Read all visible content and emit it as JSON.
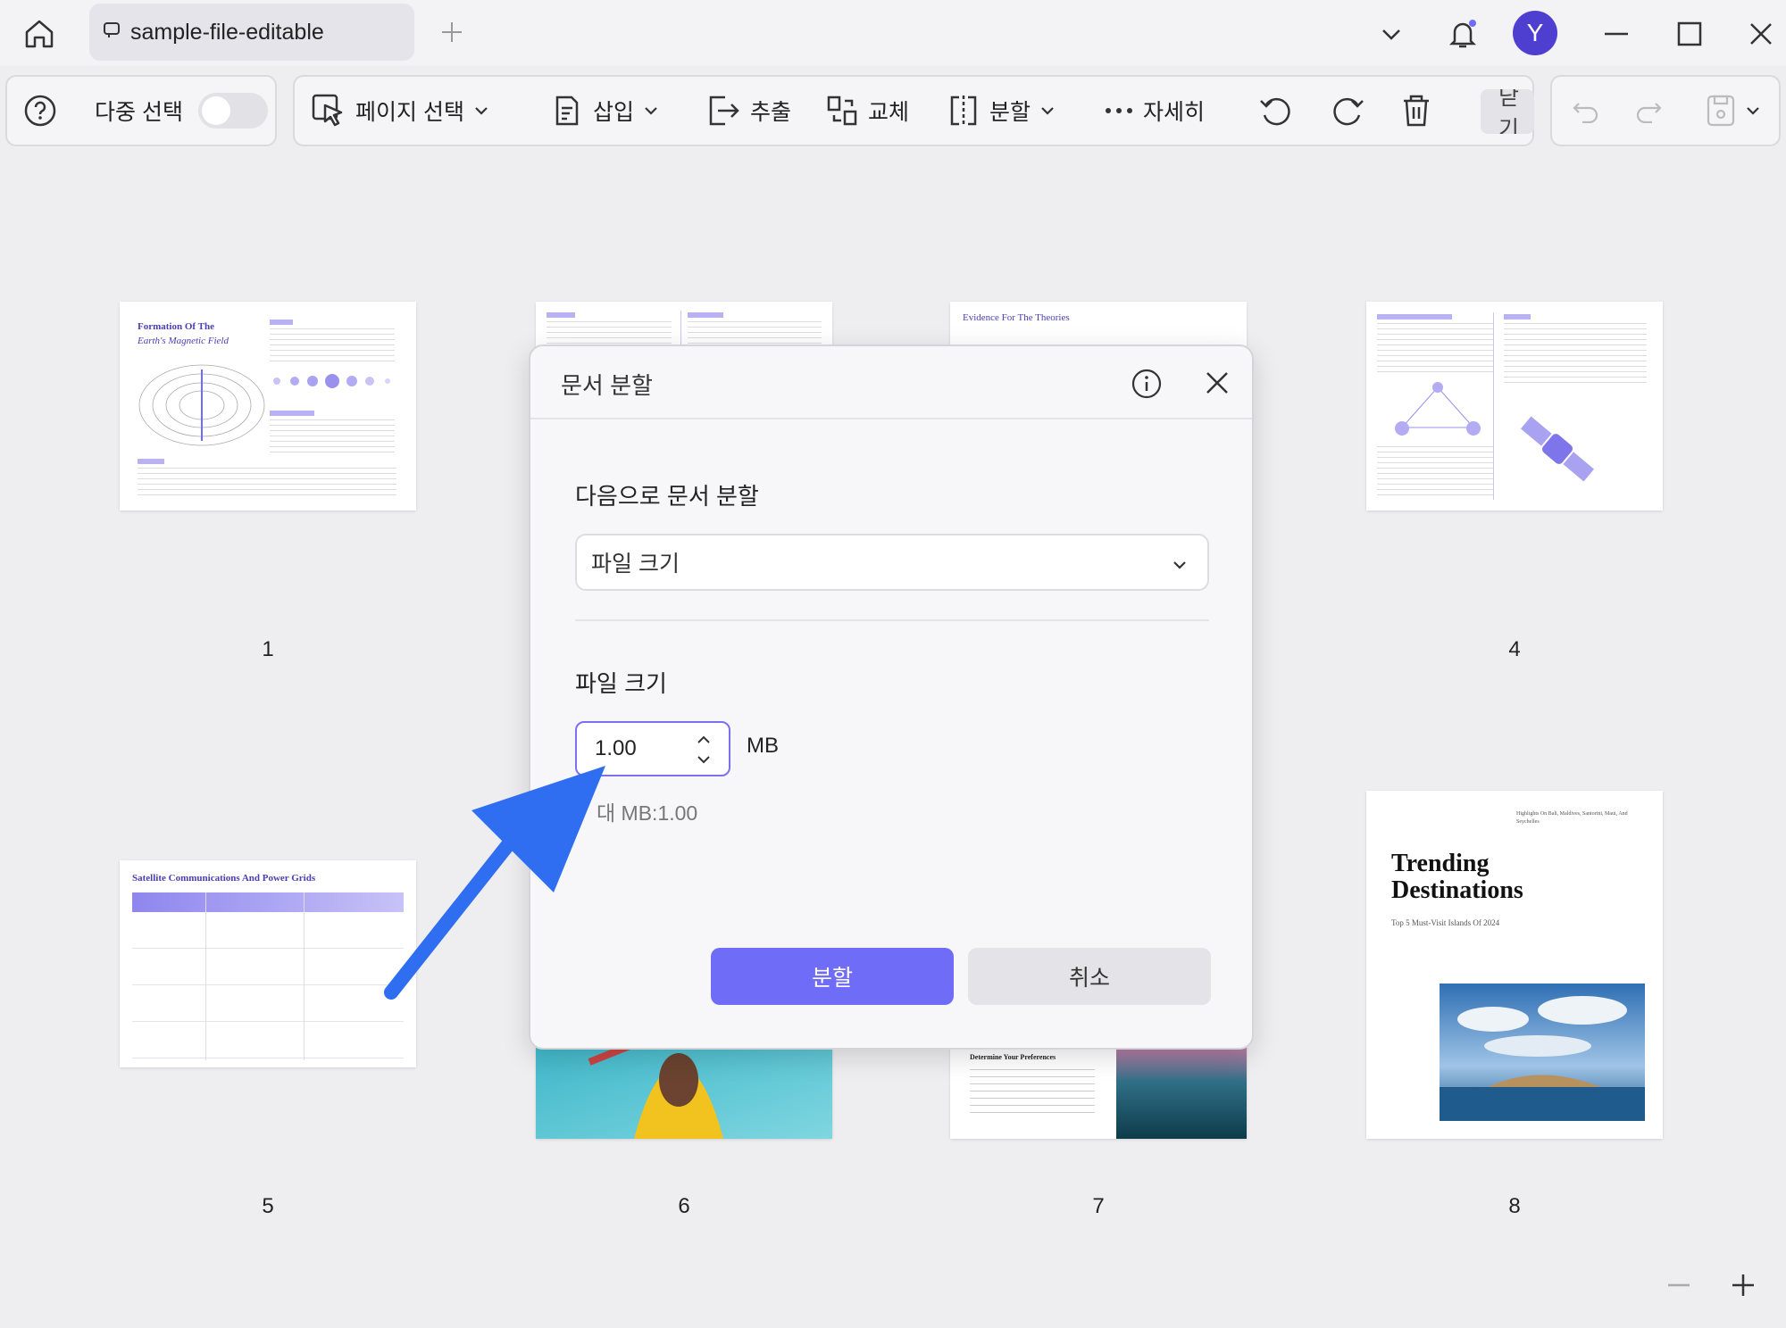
{
  "titlebar": {
    "tab_title": "sample-file-editable",
    "avatar_letter": "Y"
  },
  "toolbar": {
    "multi_select_label": "다중 선택",
    "page_select_label": "페이지 선택",
    "insert_label": "삽입",
    "extract_label": "추출",
    "replace_label": "교체",
    "split_label": "분할",
    "more_label": "자세히",
    "close_label": "닫기"
  },
  "pages": [
    {
      "number": "1",
      "title_line1": "Formation Of The",
      "title_line2": "Earth's Magnetic Field"
    },
    {
      "number": "4"
    },
    {
      "number": "5",
      "title": "Satellite Communications And Power Grids"
    },
    {
      "number": "6"
    },
    {
      "number": "7",
      "heading": "Determine Your Preferences"
    },
    {
      "number": "8",
      "top_note": "Highlights On Bali, Maldives, Santorini, Maui, And Seychelles",
      "title_line1": "Trending",
      "title_line2": "Destinations",
      "subtitle": "Top 5 Must-Visit Islands Of 2024"
    }
  ],
  "page3_heading": "Evidence For The Theories",
  "dialog": {
    "title": "문서 분할",
    "split_by_label": "다음으로 문서 분할",
    "split_by_value": "파일 크기",
    "file_size_label": "파일 크기",
    "size_value": "1.00",
    "unit": "MB",
    "max_hint": "대 MB:1.00",
    "confirm_label": "분할",
    "cancel_label": "취소"
  },
  "colors": {
    "accent": "#6f6cf7",
    "avatar": "#4f3fd1",
    "arrow": "#2f6ef0"
  }
}
